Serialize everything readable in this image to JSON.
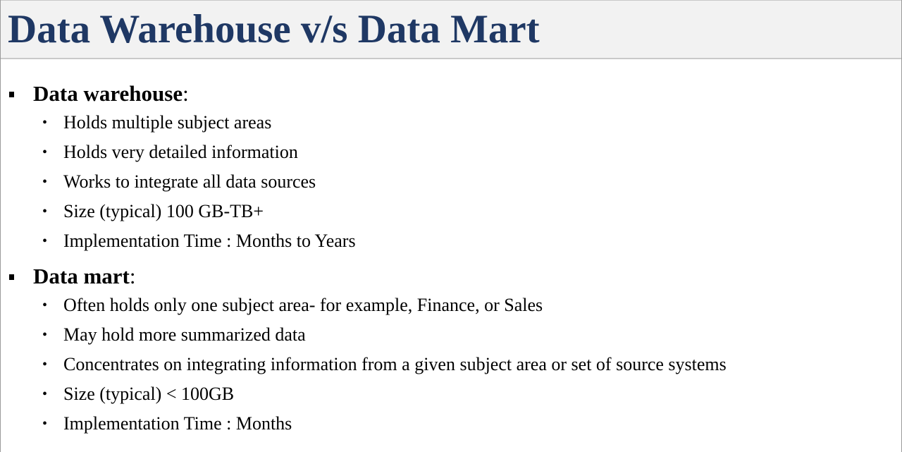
{
  "title": "Data Warehouse v/s Data Mart",
  "bullet_glyph": "•",
  "sections": [
    {
      "heading": "Data warehouse",
      "colon": ":",
      "items": [
        "Holds multiple subject areas",
        "Holds very detailed information",
        "Works to integrate all data sources",
        "Size (typical) 100 GB-TB+",
        "Implementation Time : Months to Years"
      ]
    },
    {
      "heading": "Data mart",
      "colon": ":",
      "items": [
        "Often holds only one subject area- for example, Finance, or Sales",
        "May hold more summarized data",
        "Concentrates on integrating information from a given subject area or set of source systems",
        "Size (typical) < 100GB",
        "Implementation Time : Months"
      ]
    }
  ],
  "colors": {
    "title": "#1f3864",
    "title_bar": "#f2f2f2",
    "text": "#000000"
  }
}
